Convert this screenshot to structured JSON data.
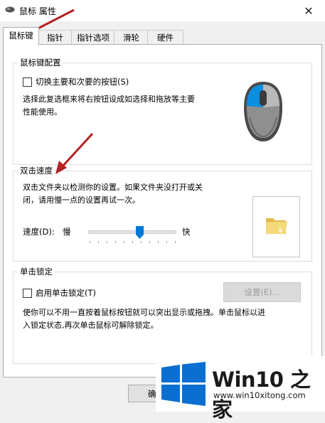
{
  "window": {
    "title": "鼠标 属性",
    "close_glyph": "✕"
  },
  "tabs": [
    {
      "label": "鼠标键",
      "active": true
    },
    {
      "label": "指针",
      "active": false
    },
    {
      "label": "指针选项",
      "active": false
    },
    {
      "label": "滑轮",
      "active": false
    },
    {
      "label": "硬件",
      "active": false
    }
  ],
  "button_config": {
    "title": "鼠标键配置",
    "checkbox_label": "切换主要和次要的按钮(S)",
    "checked": false,
    "description_line1": "选择此复选框来将右按钮设成如选择和拖放等主要",
    "description_line2": "性能使用。"
  },
  "double_click": {
    "title": "双击速度",
    "description_line1": "双击文件夹以检测你的设置。如果文件夹没打开或关",
    "description_line2": "闭，请用慢一点的设置再试一次。",
    "speed_label": "速度(D):",
    "slow_label": "慢",
    "fast_label": "快",
    "speed_fraction": 0.6
  },
  "click_lock": {
    "title": "单击锁定",
    "checkbox_label": "启用单击锁定(T)",
    "checked": false,
    "settings_button": "设置(E)...",
    "description_line1": "使你可以不用一直按着鼠标按钮就可以突出显示或拖拽。单击鼠标以进",
    "description_line2": "入锁定状态,再次单击鼠标可解除锁定。"
  },
  "footer": {
    "ok_label": "确"
  },
  "watermark": {
    "title": "Win10 之家",
    "url": "www.win10xitong.com"
  },
  "colors": {
    "accent_blue": "#0078d7",
    "arrow_red": "#b22222",
    "folder_yellow": "#f2d675"
  }
}
